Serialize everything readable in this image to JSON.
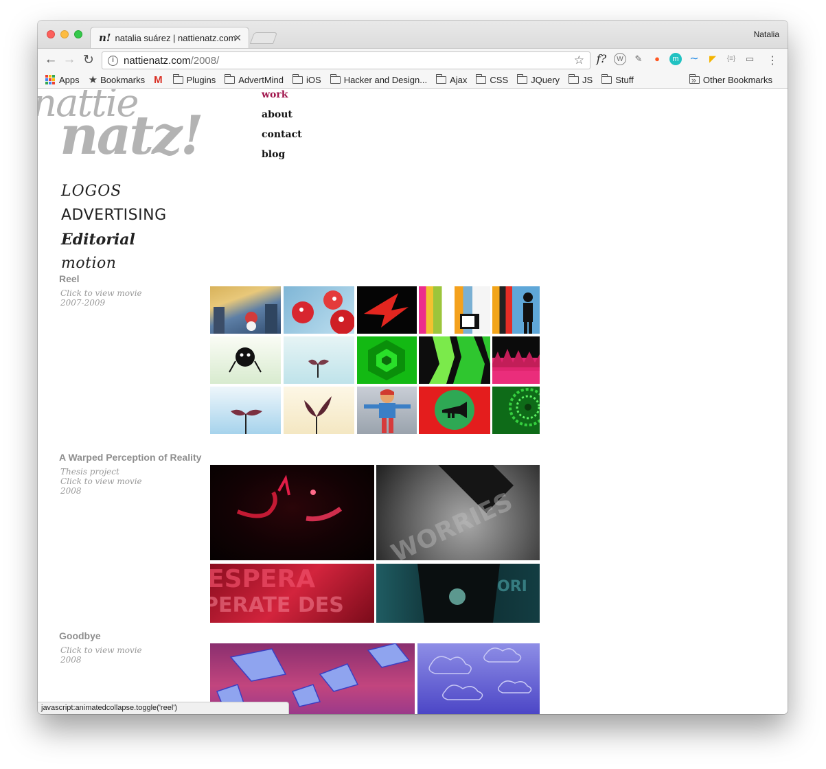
{
  "browser": {
    "tab_title": "natalia suárez | nattienatz.com",
    "tab_favicon": "n!",
    "profile_name": "Natalia",
    "url_host": "nattienatz.com",
    "url_path": "/2008/",
    "icons": [
      "back-arrow-icon",
      "forward-arrow-icon",
      "reload-icon",
      "info-icon",
      "star-icon",
      "menu-icon"
    ]
  },
  "bookmarks": {
    "items": [
      "Apps",
      "Bookmarks",
      "Plugins",
      "AdvertMind",
      "iOS",
      "Hacker and Design...",
      "Ajax",
      "CSS",
      "JQuery",
      "JS",
      "Stuff"
    ],
    "chevron": "»",
    "other": "Other Bookmarks"
  },
  "site": {
    "logo_line1": "nattie",
    "logo_line2": "natz!",
    "nav": [
      "work",
      "about",
      "contact",
      "blog"
    ],
    "active_nav": "work",
    "categories": [
      "LOGOS",
      "ADVERTISING",
      "Editorial",
      "motion"
    ]
  },
  "projects": [
    {
      "title": "Reel",
      "meta": [
        "Click to view movie",
        "2007-2009"
      ]
    },
    {
      "title": "A Warped Perception of Reality",
      "meta": [
        "Thesis project",
        "Click to view movie",
        "2008"
      ]
    },
    {
      "title": "Goodbye",
      "meta": [
        "Click to view movie",
        "2008"
      ]
    }
  ],
  "status_bar": "javascript:animatedcollapse.toggle('reel')",
  "colors": {
    "accent": "#a0154c",
    "logo_gray": "#b3b3b3"
  }
}
